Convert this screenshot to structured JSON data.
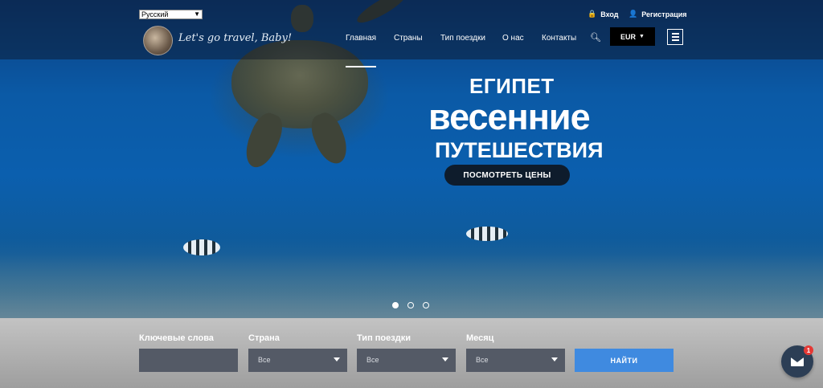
{
  "header": {
    "language": "Русский",
    "login": "Вход",
    "register": "Регистрация",
    "slogan": "Let's go travel, Baby!",
    "nav": [
      "Главная",
      "Страны",
      "Тип поездки",
      "О нас",
      "Контакты"
    ],
    "currency": "EUR"
  },
  "hero": {
    "country": "ЕГИПЕТ",
    "headline": "весенние",
    "subheadline": "ПУТЕШЕСТВИЯ",
    "cta": "ПОСМОТРЕТЬ ЦЕНЫ",
    "slides_total": 3,
    "active_slide": 1
  },
  "search": {
    "labels": {
      "keywords": "Ключевые слова",
      "country": "Страна",
      "trip_type": "Тип поездки",
      "month": "Месяц"
    },
    "keywords_value": "",
    "country_value": "Все",
    "trip_type_value": "Все",
    "month_value": "Все",
    "submit": "НАЙТИ"
  },
  "chat": {
    "badge_count": "1"
  },
  "colors": {
    "accent": "#3f8ae0",
    "dark": "#0e1c2c"
  }
}
